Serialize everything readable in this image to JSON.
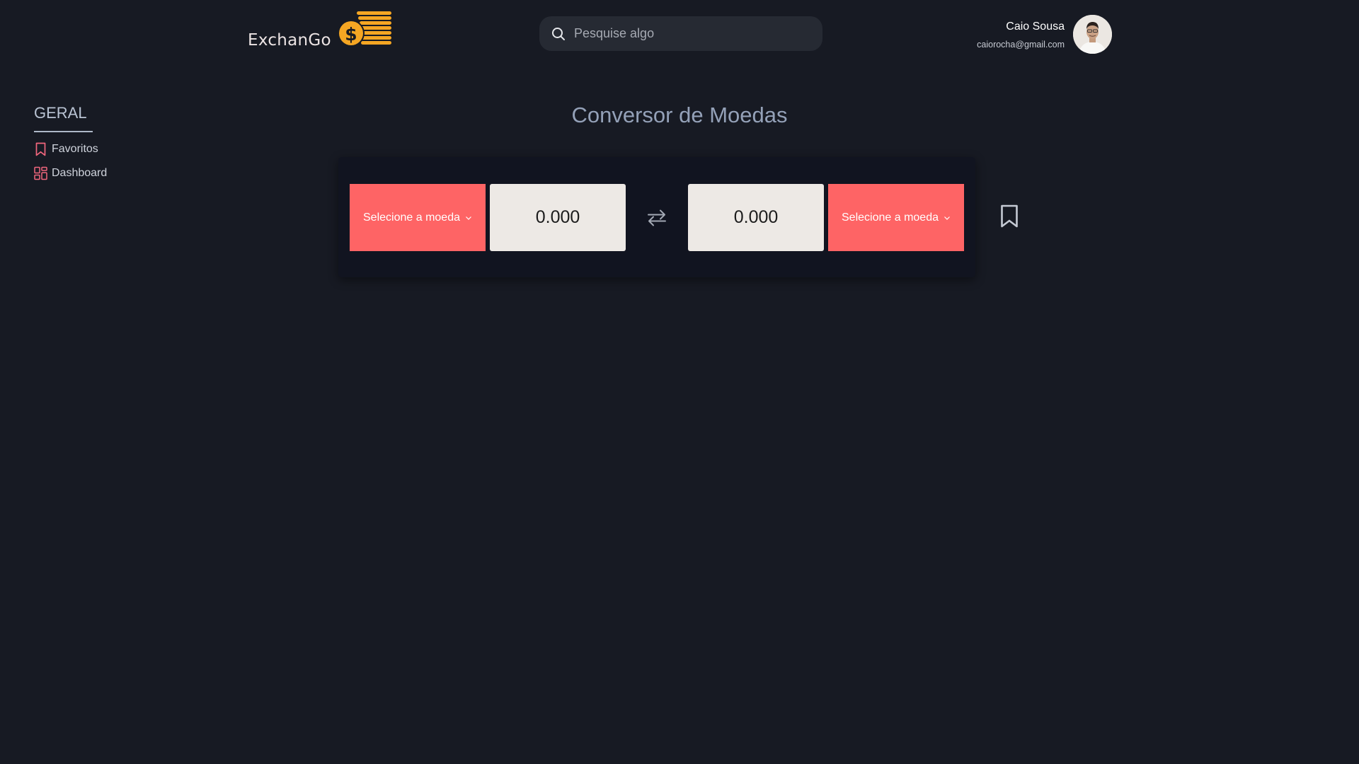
{
  "header": {
    "logo_text": "ExchanGo",
    "search": {
      "placeholder": "Pesquise algo",
      "value": ""
    },
    "user": {
      "name": "Caio Sousa",
      "email": "caiorocha@gmail.com"
    }
  },
  "sidebar": {
    "title": "GERAL",
    "items": [
      {
        "label": "Favoritos",
        "icon": "bookmark-icon"
      },
      {
        "label": "Dashboard",
        "icon": "dashboard-icon"
      }
    ]
  },
  "main": {
    "title": "Conversor de Moedas",
    "from": {
      "select_label": "Selecione a moeda",
      "value": "0.000"
    },
    "to": {
      "select_label": "Selecione a moeda",
      "value": "0.000"
    }
  },
  "colors": {
    "background": "#171a23",
    "panel": "#111420",
    "accent": "#fe6465",
    "logo_gold": "#f5a623",
    "title": "#94a1b8"
  }
}
